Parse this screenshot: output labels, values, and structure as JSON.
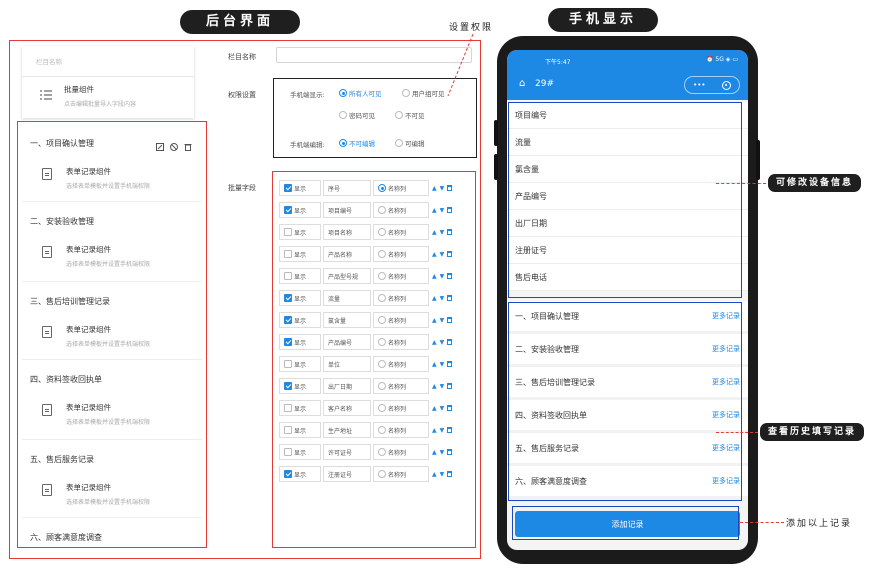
{
  "titles": {
    "backend": "后台界面",
    "mobile": "手机显示"
  },
  "annotations": {
    "set_permission": "设置权限",
    "editable": "可修改设备信息",
    "history": "查看历史填写记录",
    "add_above": "添加以上记录"
  },
  "left": {
    "column_name_placeholder": "栏目名称",
    "batch": {
      "title": "批量组件",
      "subtitle": "点击编辑批量导入字段内容"
    },
    "sections": [
      {
        "title": "一、项目确认管理"
      },
      {
        "title": "二、安装验收管理"
      },
      {
        "title": "三、售后培训管理记录"
      },
      {
        "title": "四、资料签收回执单"
      },
      {
        "title": "五、售后服务记录"
      },
      {
        "title": "六、顾客满意度调查"
      }
    ],
    "record_component": {
      "title": "表单记录组件",
      "subtitle": "选择表单模板并设置手机端权限"
    }
  },
  "form": {
    "column_name_label": "栏目名称",
    "permission_label": "权限设置",
    "mobile_display_label": "手机端显示:",
    "display_options": [
      "所有人可见",
      "用户组可见",
      "密码可见",
      "不可见"
    ],
    "mobile_edit_label": "手机端编辑:",
    "edit_options": [
      "不可编辑",
      "可编辑"
    ],
    "batch_fields_label": "批量字段",
    "show_label": "显示",
    "name_col_label": "名称列",
    "fields": [
      {
        "name": "序号",
        "show": true,
        "name_col": true
      },
      {
        "name": "项目编号",
        "show": true,
        "name_col": false
      },
      {
        "name": "项目名称",
        "show": false,
        "name_col": false
      },
      {
        "name": "产品名称",
        "show": false,
        "name_col": false
      },
      {
        "name": "产品型号规",
        "show": false,
        "name_col": false
      },
      {
        "name": "流量",
        "show": true,
        "name_col": false
      },
      {
        "name": "氯含量",
        "show": true,
        "name_col": false
      },
      {
        "name": "产品编号",
        "show": true,
        "name_col": false
      },
      {
        "name": "单位",
        "show": false,
        "name_col": false
      },
      {
        "name": "出厂日期",
        "show": true,
        "name_col": false
      },
      {
        "name": "客户名称",
        "show": false,
        "name_col": false
      },
      {
        "name": "生产地址",
        "show": false,
        "name_col": false
      },
      {
        "name": "许可证号",
        "show": false,
        "name_col": false
      },
      {
        "name": "注册证号",
        "show": true,
        "name_col": false
      }
    ]
  },
  "phone": {
    "time": "下午5:47",
    "status_right": "⏰ 5G ◈ ▭",
    "nav_title": "29#",
    "nav_menu": "•••",
    "info_rows": [
      "项目编号",
      "流量",
      "氯含量",
      "产品编号",
      "出厂日期",
      "注册证号",
      "售后电话"
    ],
    "records": [
      {
        "title": "一、项目确认管理",
        "more": "更多记录"
      },
      {
        "title": "二、安装验收管理",
        "more": "更多记录"
      },
      {
        "title": "三、售后培训管理记录",
        "more": "更多记录"
      },
      {
        "title": "四、资料签收回执单",
        "more": "更多记录"
      },
      {
        "title": "五、售后服务记录",
        "more": "更多记录"
      },
      {
        "title": "六、顾客满意度调查",
        "more": "更多记录"
      }
    ],
    "add_button": "添加记录"
  }
}
